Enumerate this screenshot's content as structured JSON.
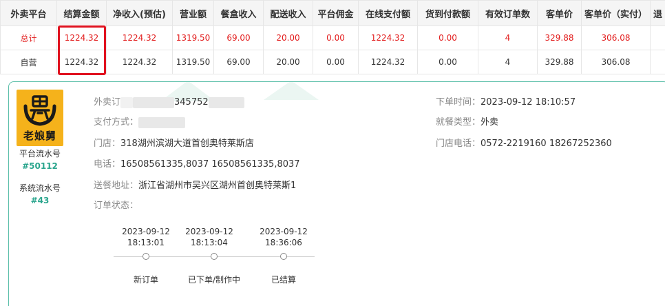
{
  "table": {
    "headers": [
      "外卖平台",
      "结算金额",
      "净收入(预估)",
      "营业额",
      "餐盒收入",
      "配送收入",
      "平台佣金",
      "在线支付额",
      "货到付款额",
      "有效订单数",
      "客单价",
      "客单价（实付）",
      "退"
    ],
    "rows": [
      [
        "总计",
        "1224.32",
        "1224.32",
        "1319.50",
        "69.00",
        "20.00",
        "0.00",
        "1224.32",
        "0.00",
        "4",
        "329.88",
        "306.08",
        ""
      ],
      [
        "自营",
        "1224.32",
        "1224.32",
        "1319.50",
        "69.00",
        "20.00",
        "0.00",
        "1224.32",
        "0.00",
        "4",
        "329.88",
        "306.08",
        ""
      ]
    ]
  },
  "order": {
    "logo_text": "老娘舅",
    "platform_serial_label": "平台流水号",
    "platform_serial_value": "#50112",
    "system_serial_label": "系统流水号",
    "system_serial_value": "#43",
    "order_no_label": "外卖订",
    "order_no_partial": "345752",
    "payment_label": "支付方式：",
    "store_label": "门店：",
    "store_value": "318湖州滨湖大道首创奥特莱斯店",
    "phone_label": "电话：",
    "phone_value": "16508561335,8037 16508561335,8037",
    "address_label": "送餐地址：",
    "address_value": "浙江省湖州市吴兴区湖州首创奥特莱斯1",
    "status_label": "订单状态：",
    "order_time_label": "下单时间：",
    "order_time_value": "2023-09-12 18:10:57",
    "dining_type_label": "就餐类型：",
    "dining_type_value": "外卖",
    "store_phone_label": "门店电话：",
    "store_phone_value": "0572-2219160 18267252360"
  },
  "timeline": [
    {
      "date": "2023-09-12",
      "time": "18:13:01",
      "label": "新订单"
    },
    {
      "date": "2023-09-12",
      "time": "18:13:04",
      "label": "已下单/制作中"
    },
    {
      "date": "2023-09-12",
      "time": "18:36:06",
      "label": "已结算"
    }
  ],
  "colors": {
    "highlight": "#e0121f",
    "total_row_text": "#e21c1c",
    "serial_accent": "#2aa58d",
    "card_border": "#5bbfa9",
    "logo_bg": "#f5b21b"
  }
}
